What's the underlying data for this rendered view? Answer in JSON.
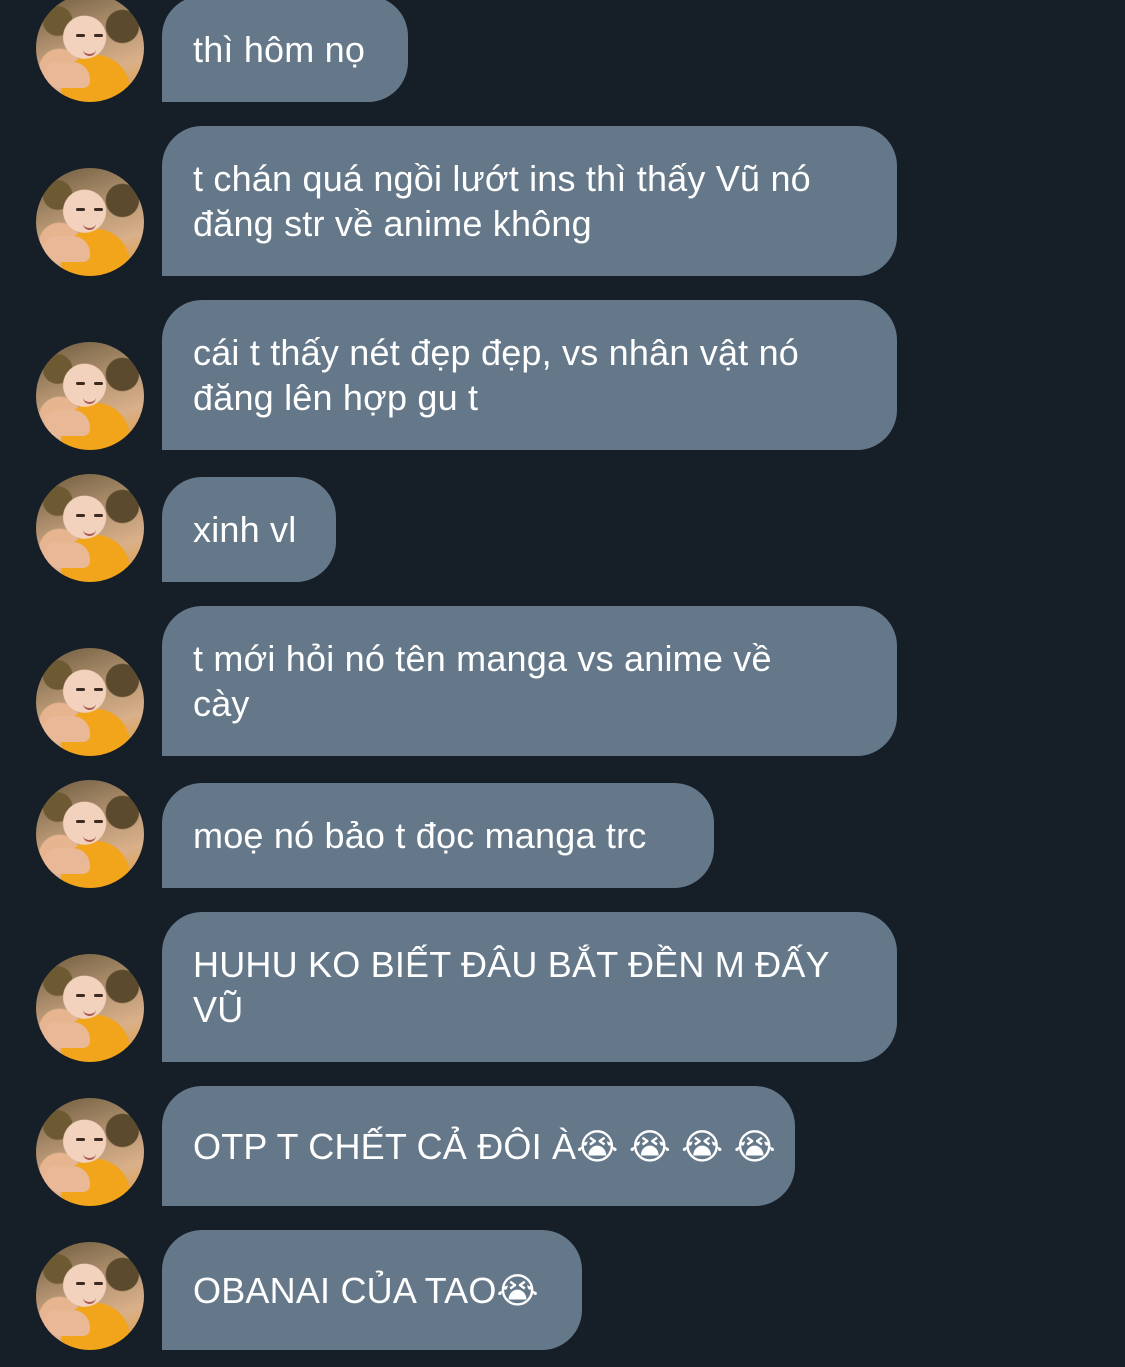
{
  "messages": [
    {
      "text": "thì hôm nọ"
    },
    {
      "text": "t chán quá ngồi lướt ins thì thấy Vũ nó\nđăng str về anime không"
    },
    {
      "text": "cái t thấy nét đẹp đẹp, vs nhân vật nó\nđăng lên hợp gu t"
    },
    {
      "text": "xinh vl"
    },
    {
      "text": "t mới hỏi nó tên manga vs anime về\ncày"
    },
    {
      "text": "moẹ nó bảo t đọc manga trc"
    },
    {
      "text": "HUHU KO BIẾT ĐÂU BẮT ĐỀN M ĐẤY\nVŨ"
    },
    {
      "text": "OTP T CHẾT CẢ ĐÔI À😭 😭 😭 😭"
    },
    {
      "text": "OBANAI CỦA TAO😭"
    }
  ],
  "colors": {
    "background": "#161e28",
    "bubble": "#65788a",
    "text": "#ffffff"
  }
}
